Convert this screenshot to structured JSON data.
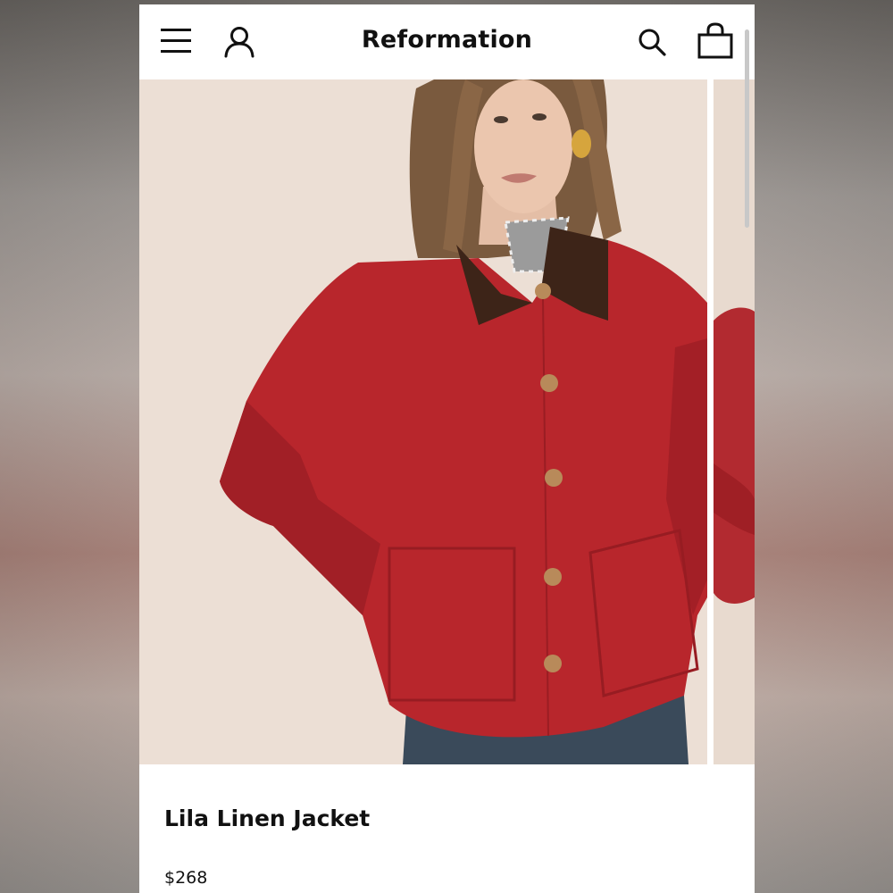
{
  "header": {
    "brand": "Reformation",
    "icons": [
      "menu-icon",
      "account-icon",
      "search-icon",
      "shopping-bag-icon"
    ]
  },
  "product": {
    "name": "Lila Linen Jacket",
    "price": "$268"
  },
  "colors": {
    "jacket": "#b8262c",
    "collar": "#3d2418",
    "background": "#ecdfd5",
    "denim": "#3a4a5a"
  }
}
